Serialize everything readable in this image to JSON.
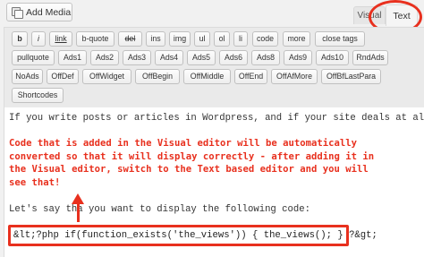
{
  "header": {
    "add_media_label": "Add Media",
    "tab_visual": "Visual",
    "tab_text": "Text"
  },
  "toolbar": {
    "row1": [
      "b",
      "i",
      "link",
      "b-quote",
      "del",
      "ins",
      "img",
      "ul",
      "ol",
      "li",
      "code",
      "more",
      "close tags"
    ],
    "row2": [
      "pullquote",
      "Ads1",
      "Ads2",
      "Ads3",
      "Ads4",
      "Ads5",
      "Ads6",
      "Ads8",
      "Ads9",
      "Ads10",
      "RndAds"
    ],
    "row3": [
      "NoAds",
      "OffDef",
      "OffWidget",
      "OffBegin",
      "OffMiddle",
      "OffEnd",
      "OffAfMore",
      "OffBfLastPara"
    ],
    "row4": [
      "Shortcodes"
    ]
  },
  "editor": {
    "line1": "If you write posts or articles in Wordpress, and if your site deals at all",
    "annotation_lines": [
      "Code that is added in the Visual editor will be automatically",
      "converted so that it will display correctly - after adding it in",
      "the Visual editor, switch to the Text based editor and you will",
      "see that!"
    ],
    "line2": "Let's say tha   you want to display the following code:",
    "code_line": "&lt;?php if(function_exists('the_views')) { the_views(); } ?&gt;"
  },
  "colors": {
    "annotation_red": "#e8301e",
    "editor_background": "#ffffff",
    "toolbar_background": "#eaeaea"
  }
}
